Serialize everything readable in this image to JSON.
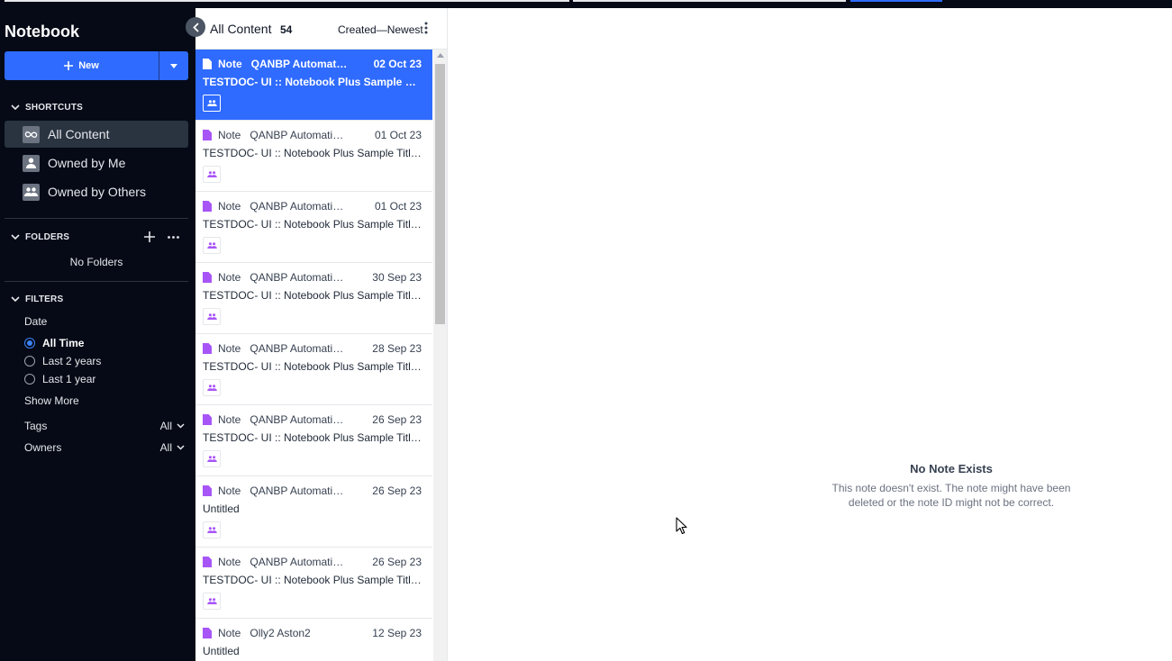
{
  "sidebar": {
    "brand": "Notebook",
    "new_label": "New",
    "shortcuts_heading": "SHORTCUTS",
    "shortcuts": [
      {
        "label": "All Content",
        "icon": "infinity-icon",
        "active": true
      },
      {
        "label": "Owned by Me",
        "icon": "person-icon",
        "active": false
      },
      {
        "label": "Owned by Others",
        "icon": "people-icon",
        "active": false
      }
    ],
    "folders_heading": "FOLDERS",
    "no_folders": "No Folders",
    "filters_heading": "FILTERS",
    "date_label": "Date",
    "date_options": [
      {
        "label": "All Time",
        "selected": true
      },
      {
        "label": "Last 2 years",
        "selected": false
      },
      {
        "label": "Last 1 year",
        "selected": false
      }
    ],
    "show_more": "Show More",
    "tags_label": "Tags",
    "tags_value": "All",
    "owners_label": "Owners",
    "owners_value": "All"
  },
  "list": {
    "title": "All Content",
    "count": "54",
    "sort": "Created—Newest",
    "items": [
      {
        "type": "Note",
        "owner": "QANBP Automation User",
        "date": "02 Oct 23",
        "title": "TESTDOC- UI :: Notebook Plus Sample Title for Automation",
        "selected": true
      },
      {
        "type": "Note",
        "owner": "QANBP Automation User",
        "date": "01 Oct 23",
        "title": "TESTDOC- UI :: Notebook Plus Sample Title for Automation",
        "selected": false
      },
      {
        "type": "Note",
        "owner": "QANBP Automation User",
        "date": "01 Oct 23",
        "title": "TESTDOC- UI :: Notebook Plus Sample Title for Automation",
        "selected": false
      },
      {
        "type": "Note",
        "owner": "QANBP Automation User",
        "date": "30 Sep 23",
        "title": "TESTDOC- UI :: Notebook Plus Sample Title for Automation",
        "selected": false
      },
      {
        "type": "Note",
        "owner": "QANBP Automation User",
        "date": "28 Sep 23",
        "title": "TESTDOC- UI :: Notebook Plus Sample Title for Automation",
        "selected": false
      },
      {
        "type": "Note",
        "owner": "QANBP Automation User",
        "date": "26 Sep 23",
        "title": "TESTDOC- UI :: Notebook Plus Sample Title for Automation",
        "selected": false
      },
      {
        "type": "Note",
        "owner": "QANBP Automation User",
        "date": "26 Sep 23",
        "title": "Untitled",
        "selected": false
      },
      {
        "type": "Note",
        "owner": "QANBP Automation User",
        "date": "26 Sep 23",
        "title": "TESTDOC- UI :: Notebook Plus Sample Title for Automation",
        "selected": false
      },
      {
        "type": "Note",
        "owner": "Olly2 Aston2",
        "date": "12 Sep 23",
        "title": "Untitled",
        "selected": false
      }
    ]
  },
  "main": {
    "empty_title": "No Note Exists",
    "empty_desc": "This note doesn't exist. The note might have been deleted or the note ID might not be correct."
  },
  "colors": {
    "accent": "#2f6bff",
    "sidebar_bg": "#050a16",
    "note_icon": "#a855f7",
    "share_icon": "#a855f7"
  }
}
